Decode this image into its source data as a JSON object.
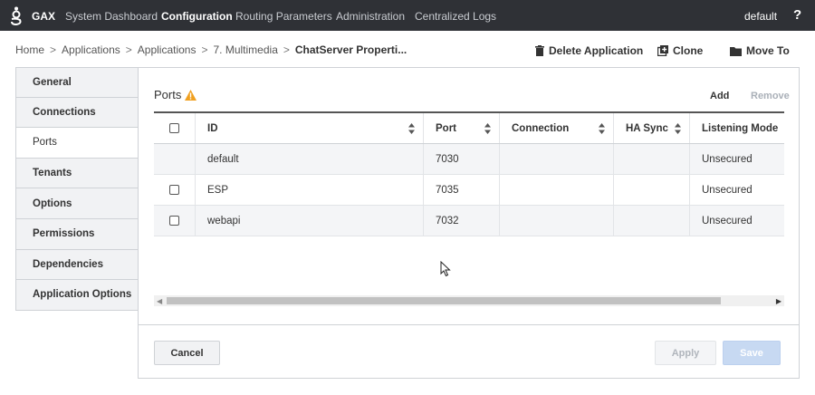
{
  "topbar": {
    "brand": "GAX",
    "nav": [
      "System Dashboard",
      "Configuration",
      "Routing Parameters",
      "Administration",
      "Centralized Logs"
    ],
    "active_nav": "Configuration",
    "user": "default",
    "help": "?"
  },
  "breadcrumb": {
    "items": [
      "Home",
      "Applications",
      "Applications",
      "7. Multimedia"
    ],
    "separator": ">",
    "current": "ChatServer Properti..."
  },
  "actions": {
    "delete": "Delete Application",
    "clone": "Clone",
    "move": "Move To"
  },
  "sidebar": {
    "items": [
      "General",
      "Connections",
      "Ports",
      "Tenants",
      "Options",
      "Permissions",
      "Dependencies",
      "Application Options"
    ],
    "active": "Ports"
  },
  "ports": {
    "title": "Ports",
    "add_label": "Add",
    "remove_label": "Remove",
    "columns": [
      "ID",
      "Port",
      "Connection",
      "HA Sync",
      "Listening Mode"
    ],
    "rows": [
      {
        "id": "default",
        "port": "7030",
        "connection": "",
        "ha_sync": "",
        "mode": "Unsecured",
        "has_checkbox": false
      },
      {
        "id": "ESP",
        "port": "7035",
        "connection": "",
        "ha_sync": "",
        "mode": "Unsecured",
        "has_checkbox": true
      },
      {
        "id": "webapi",
        "port": "7032",
        "connection": "",
        "ha_sync": "",
        "mode": "Unsecured",
        "has_checkbox": true
      }
    ]
  },
  "footer": {
    "cancel": "Cancel",
    "apply": "Apply",
    "save": "Save"
  },
  "colors": {
    "topbar_bg": "#2f3136",
    "warning": "#f0a020",
    "save_disabled": "#c7d9f2"
  }
}
